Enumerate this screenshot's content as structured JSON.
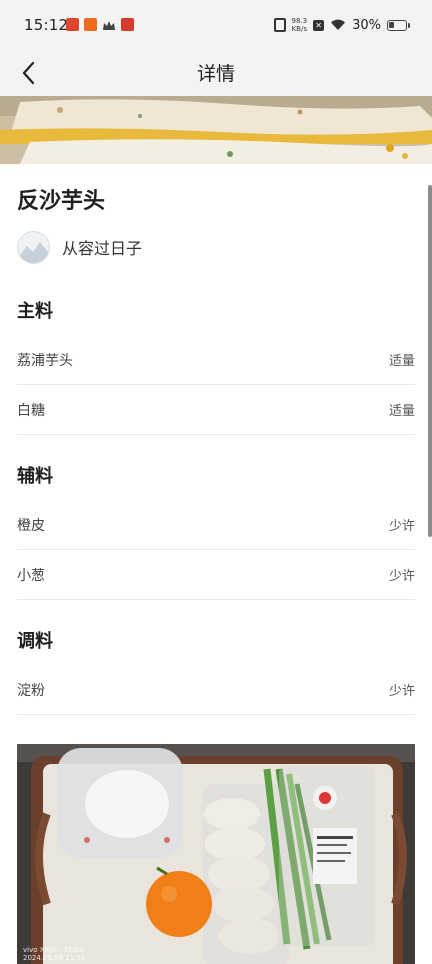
{
  "status_bar": {
    "time": "15:12",
    "net_speed_value": "98.3",
    "net_speed_unit": "KB/s",
    "battery": "30%"
  },
  "nav": {
    "title": "详情",
    "back_icon": "chevron-left-icon"
  },
  "recipe": {
    "title": "反沙芋头",
    "author": "从容过日子"
  },
  "sections": [
    {
      "title": "主料",
      "items": [
        {
          "name": "荔浦芋头",
          "amount": "适量"
        },
        {
          "name": "白糖",
          "amount": "适量"
        }
      ]
    },
    {
      "title": "辅料",
      "items": [
        {
          "name": "橙皮",
          "amount": "少许"
        },
        {
          "name": "小葱",
          "amount": "少许"
        }
      ]
    },
    {
      "title": "调料",
      "items": [
        {
          "name": "淀粉",
          "amount": "少许"
        }
      ]
    }
  ],
  "photo": {
    "caption_line1": "vivo X90s · ZEISS",
    "caption_line2": "2024.05.06 11:51"
  },
  "colors": {
    "bar_bg": "#f3f3f3",
    "divider": "#e8e8e8",
    "text_primary": "#1f1f1f"
  }
}
